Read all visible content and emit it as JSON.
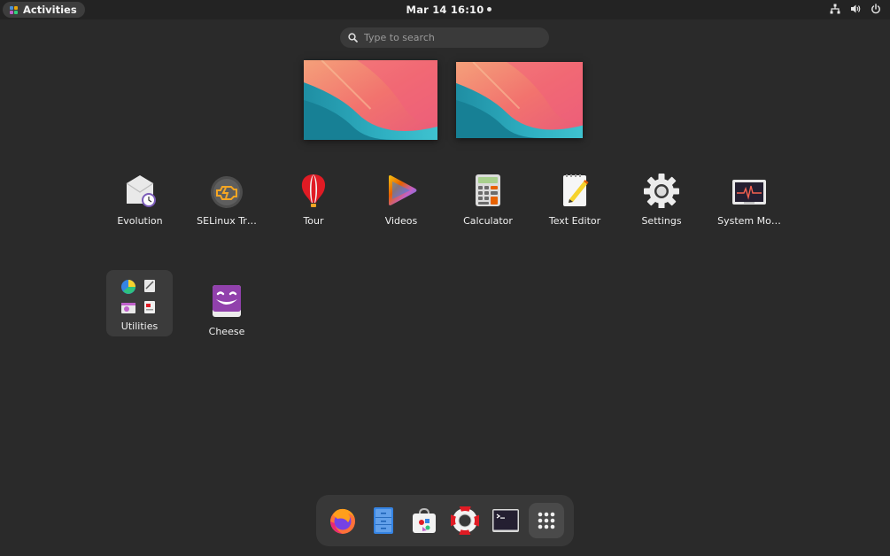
{
  "topbar": {
    "activities_label": "Activities",
    "clock": "Mar 14  16:10",
    "icons": [
      "network-icon",
      "volume-icon",
      "power-icon"
    ]
  },
  "search": {
    "placeholder": "Type to search"
  },
  "workspaces": [
    {
      "name": "workspace-1"
    },
    {
      "name": "workspace-2"
    }
  ],
  "apps": [
    {
      "label": "Evolution",
      "icon": "evolution-icon"
    },
    {
      "label": "SELinux Tr…",
      "icon": "selinux-troubleshooter-icon"
    },
    {
      "label": "Tour",
      "icon": "tour-balloon-icon"
    },
    {
      "label": "Videos",
      "icon": "videos-icon"
    },
    {
      "label": "Calculator",
      "icon": "calculator-icon"
    },
    {
      "label": "Text Editor",
      "icon": "text-editor-icon"
    },
    {
      "label": "Settings",
      "icon": "settings-gear-icon"
    },
    {
      "label": "System Mo…",
      "icon": "system-monitor-icon"
    },
    {
      "label": "Utilities",
      "icon": "utilities-folder-icon"
    },
    {
      "label": "Cheese",
      "icon": "cheese-icon"
    }
  ],
  "dash": [
    "firefox-icon",
    "files-icon",
    "software-icon",
    "help-icon",
    "terminal-icon",
    "show-apps-grid-icon"
  ],
  "colors": {
    "background": "#2a2a2a",
    "topbar": "#232323",
    "dash": "#383838",
    "folder": "#3b3b3b"
  }
}
